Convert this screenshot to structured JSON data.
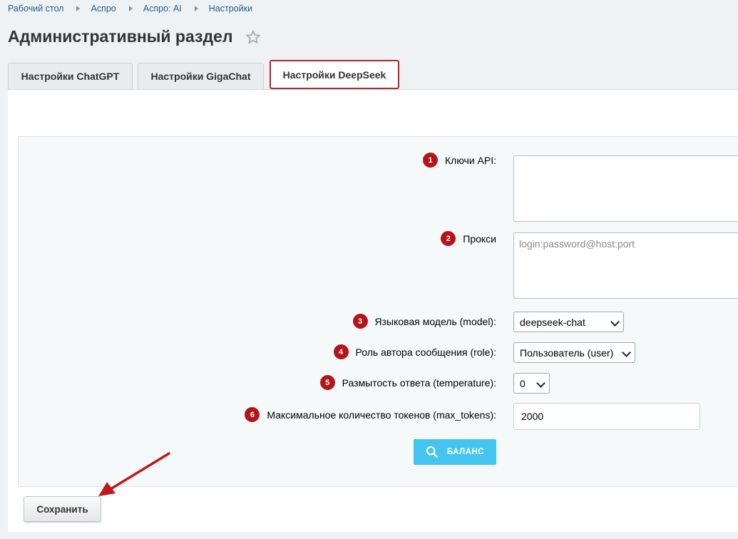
{
  "breadcrumb": [
    "Рабочий стол",
    "Аспро",
    "Аспро: AI",
    "Настройки"
  ],
  "page_title": "Административный раздел",
  "tabs": [
    {
      "label": "Настройки ChatGPT"
    },
    {
      "label": "Настройки GigaChat"
    },
    {
      "label": "Настройки DeepSeek",
      "active": true
    }
  ],
  "form": {
    "api_keys": {
      "badge": "1",
      "label": "Ключи API:",
      "value": ""
    },
    "proxy": {
      "badge": "2",
      "label": "Прокси",
      "placeholder": "login:password@host:port"
    },
    "model": {
      "badge": "3",
      "label": "Языковая модель (model):",
      "value": "deepseek-chat"
    },
    "role": {
      "badge": "4",
      "label": "Роль автора сообщения (role):",
      "value": "Пользователь (user)"
    },
    "temperature": {
      "badge": "5",
      "label": "Размытость ответа (temperature):",
      "value": "0"
    },
    "max_tokens": {
      "badge": "6",
      "label": "Максимальное количество токенов (max_tokens):",
      "value": "2000"
    }
  },
  "buttons": {
    "balance": "БАЛАНС",
    "save": "Сохранить"
  },
  "colors": {
    "accent_red": "#b3151b",
    "balance_blue": "#44c5ef",
    "arrow": "#c0171c"
  },
  "icons": {
    "star": "star-icon",
    "search": "search-icon",
    "arrow": "arrow-icon"
  }
}
